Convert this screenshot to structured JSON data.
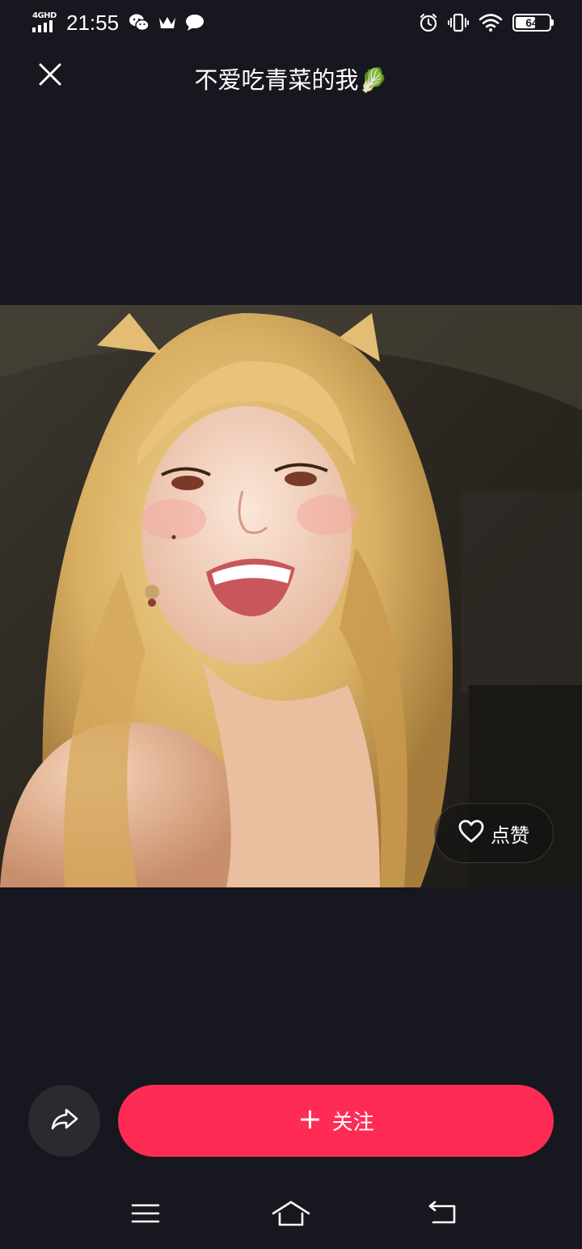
{
  "status_bar": {
    "network": "4GHD",
    "time": "21:55",
    "icons_left": [
      "wechat-icon",
      "crown-icon",
      "chat-bubble-icon"
    ],
    "icons_right": [
      "alarm-icon",
      "vibrate-icon",
      "wifi-icon"
    ],
    "battery_level": "64",
    "battery_fraction": 0.64
  },
  "header": {
    "title": "不爱吃青菜的我🥬",
    "close_icon": "close-icon"
  },
  "photo": {
    "subject": "portrait photo"
  },
  "actions": {
    "like_label": "点赞",
    "like_icon": "heart-icon",
    "share_icon": "share-arrow-icon",
    "follow_plus": "+",
    "follow_label": "关注"
  },
  "nav": {
    "menu_icon": "menu-icon",
    "home_icon": "home-icon",
    "back_icon": "back-icon"
  },
  "colors": {
    "background": "#17171f",
    "accent": "#fe2c55",
    "share_bg": "#2a2a31"
  }
}
